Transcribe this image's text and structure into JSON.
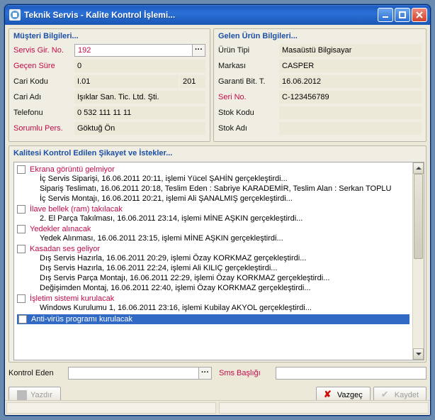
{
  "window": {
    "title": "Teknik Servis - Kalite Kontrol İşlemi..."
  },
  "left": {
    "title": "Müşteri Bilgileri...",
    "fields": {
      "servis_no_label": "Servis Gir. No.",
      "servis_no": "192",
      "gecen_sure_label": "Geçen Süre",
      "gecen_sure": "0",
      "cari_kodu_label": "Cari Kodu",
      "cari_kodu": "I.01",
      "cari_kodu2": "201",
      "cari_adi_label": "Cari Adı",
      "cari_adi": "Işıklar San. Tic. Ltd. Şti.",
      "telefon_label": "Telefonu",
      "telefon": "0 532 111 11 11",
      "sorumlu_label": "Sorumlu Pers.",
      "sorumlu": "Göktuğ Ön"
    }
  },
  "right": {
    "title": "Gelen Ürün Bilgileri...",
    "fields": {
      "urun_tipi_label": "Ürün Tipi",
      "urun_tipi": "Masaüstü Bilgisayar",
      "marka_label": "Markası",
      "marka": "CASPER",
      "garanti_label": "Garanti Bit. T.",
      "garanti": "16.06.2012",
      "seri_label": "Seri No.",
      "seri": "C-123456789",
      "stok_kodu_label": "Stok Kodu",
      "stok_kodu": "",
      "stok_adi_label": "Stok Adı",
      "stok_adi": ""
    }
  },
  "list": {
    "title": "Kalitesi Kontrol Edilen Şikayet ve İstekler...",
    "items": [
      {
        "title": "Ekrana görüntü gelmiyor",
        "selected": false,
        "lines": [
          "İç Servis Siparişi,  16.06.2011 20:11,  işlemi Yücel ŞAHİN gerçekleştirdi...",
          "Sipariş Teslimatı,  16.06.2011 20:18,  Teslim Eden : Sabriye KARADEMİR, Teslim Alan : Serkan TOPLU",
          "İç Servis Montajı,  16.06.2011 20:21,  işlemi Ali ŞANALMIŞ gerçekleştirdi..."
        ]
      },
      {
        "title": "İlave bellek (ram) takılacak",
        "selected": false,
        "lines": [
          "2. El Parça Takılması,  16.06.2011 23:14,  işlemi MİNE AŞKIN gerçekleştirdi..."
        ]
      },
      {
        "title": "Yedekler alınacak",
        "selected": false,
        "lines": [
          "Yedek Alınması,  16.06.2011 23:15,  işlemi MİNE AŞKIN gerçekleştirdi..."
        ]
      },
      {
        "title": "Kasadan ses geliyor",
        "selected": false,
        "lines": [
          "Dış Servis Hazırla,  16.06.2011 20:29,  işlemi Özay KORKMAZ gerçekleştirdi...",
          "Dış Servis Hazırla,  16.06.2011 22:24,  işlemi Ali KILIÇ gerçekleştirdi...",
          "Dış Servis Parça Montajı,  16.06.2011 22:29,  işlemi Özay KORKMAZ gerçekleştirdi...",
          "Değişimden Montaj,  16.06.2011 22:40,  işlemi Özay KORKMAZ gerçekleştirdi..."
        ]
      },
      {
        "title": "İşletim sistemi kurulacak",
        "selected": false,
        "lines": [
          "Windows Kurulumu 1,  16.06.2011 23:16,  işlemi Kubilay AKYOL gerçekleştirdi..."
        ]
      },
      {
        "title": "Anti-virüs programı kurulacak",
        "selected": true,
        "lines": []
      }
    ]
  },
  "footer": {
    "kontrol_label": "Kontrol Eden",
    "kontrol_val": "",
    "sms_label": "Sms Başlığı",
    "sms_val": "",
    "yazdir": "Yazdır",
    "vazgec": "Vazgeç",
    "kaydet": "Kaydet"
  }
}
